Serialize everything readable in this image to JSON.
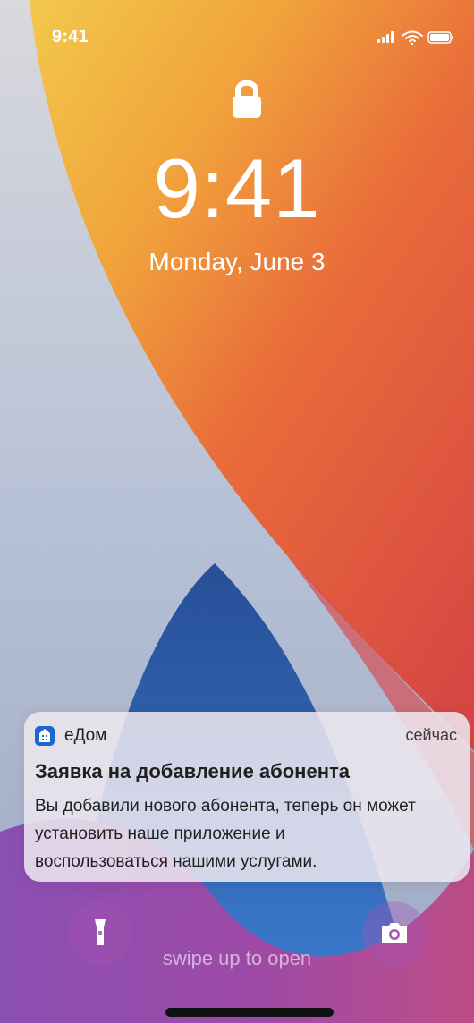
{
  "status_bar": {
    "time": "9:41"
  },
  "lock_screen": {
    "time": "9:41",
    "date": "Monday, June 3",
    "swipe_text": "swipe up to open"
  },
  "notification": {
    "app_name": "еДом",
    "timestamp": "сейчас",
    "title": "Заявка на добавление абонента",
    "body_lines": [
      "Вы добавили нового абонента, теперь он может",
      "установить наше приложение и",
      "воспользоваться нашими услугами."
    ],
    "icon": "edom-app-icon",
    "icon_color": "#1f66d1"
  },
  "icons": {
    "lock": "lock-icon",
    "flashlight": "flashlight-icon",
    "camera": "camera-icon",
    "signal": "signal-icon",
    "wifi": "wifi-icon",
    "battery": "battery-icon"
  },
  "colors": {
    "wallpaper_yellow": "#f2c84b",
    "wallpaper_orange": "#ec8a36",
    "wallpaper_red": "#df4d3f",
    "wallpaper_blue": "#2d67b7",
    "wallpaper_purple": "#8e52b3",
    "wallpaper_silver": "#b9c2d6"
  }
}
